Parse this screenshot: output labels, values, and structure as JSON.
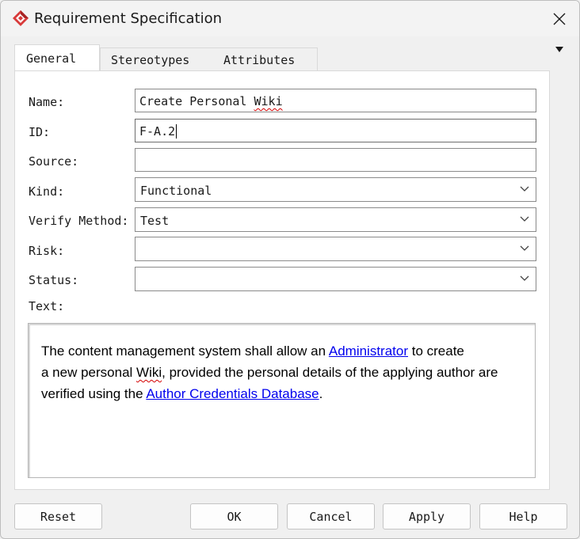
{
  "window": {
    "title": "Requirement Specification",
    "app_icon": "diamond-logo-icon",
    "close_icon": "close-icon",
    "menu_icon": "triangle-down-icon"
  },
  "tabs": [
    {
      "label": "General",
      "active": true
    },
    {
      "label": "Stereotypes",
      "active": false
    },
    {
      "label": "Attributes",
      "active": false
    }
  ],
  "form": {
    "name": {
      "label": "Name:",
      "value_prefix": "Create Personal ",
      "value_misspelled": "Wiki"
    },
    "id": {
      "label": "ID:",
      "value": "F-A.2"
    },
    "source": {
      "label": "Source:",
      "value": ""
    },
    "kind": {
      "label": "Kind:",
      "value": "Functional"
    },
    "verify_method": {
      "label": "Verify Method:",
      "value": "Test"
    },
    "risk": {
      "label": "Risk:",
      "value": ""
    },
    "status": {
      "label": "Status:",
      "value": ""
    },
    "text_label": "Text:"
  },
  "text_content": {
    "part1": "The content management system shall allow an ",
    "link1": "Administrator",
    "part2": " to create",
    "part3": "a new personal ",
    "misspelled": "Wiki",
    "part4": ", provided the personal details of the applying author are",
    "part5": "verified using the ",
    "link2": "Author Credentials Database",
    "part6": "."
  },
  "buttons": {
    "reset": "Reset",
    "ok": "OK",
    "cancel": "Cancel",
    "apply": "Apply",
    "help": "Help"
  },
  "colors": {
    "accent_logo": "#d83a3a",
    "link": "#0000ee",
    "spellcheck": "#d40000"
  }
}
